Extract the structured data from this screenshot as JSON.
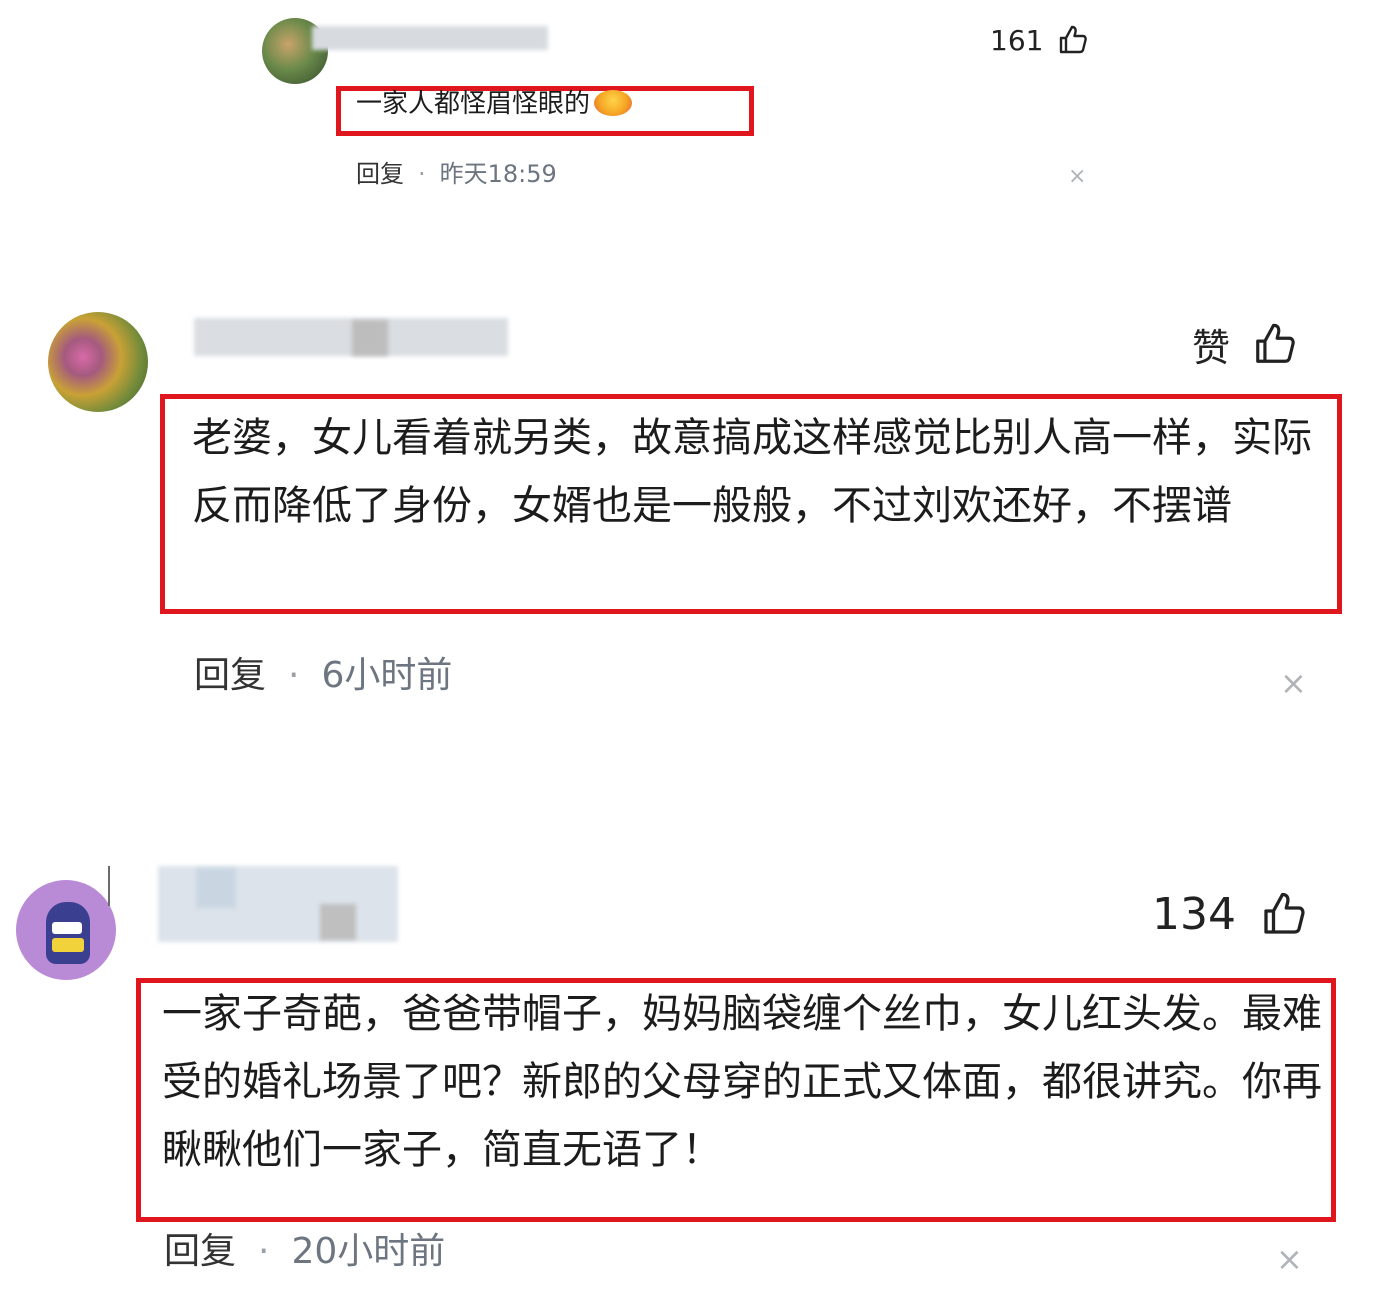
{
  "comments": [
    {
      "like_count": "161",
      "text": "一家人都怪眉怪眼的",
      "reply_label": "回复",
      "time": "昨天18:59",
      "emoji": "face-emoji"
    },
    {
      "like_label": "赞",
      "text": "老婆，女儿看着就另类，故意搞成这样感觉比别人高一样，实际反而降低了身份，女婿也是一般般，不过刘欢还好，不摆谱",
      "reply_label": "回复",
      "time": "6小时前"
    },
    {
      "like_count": "134",
      "text": "一家子奇葩，爸爸带帽子，妈妈脑袋缠个丝巾，女儿红头发。最难受的婚礼场景了吧？新郎的父母穿的正式又体面，都很讲究。你再瞅瞅他们一家子，简直无语了！",
      "reply_label": "回复",
      "time": "20小时前"
    }
  ],
  "close_glyph": "×",
  "colors": {
    "highlight": "#e0161f",
    "time": "#6c7580"
  },
  "icons": [
    "thumbs-up-icon",
    "close-icon",
    "avatar"
  ]
}
